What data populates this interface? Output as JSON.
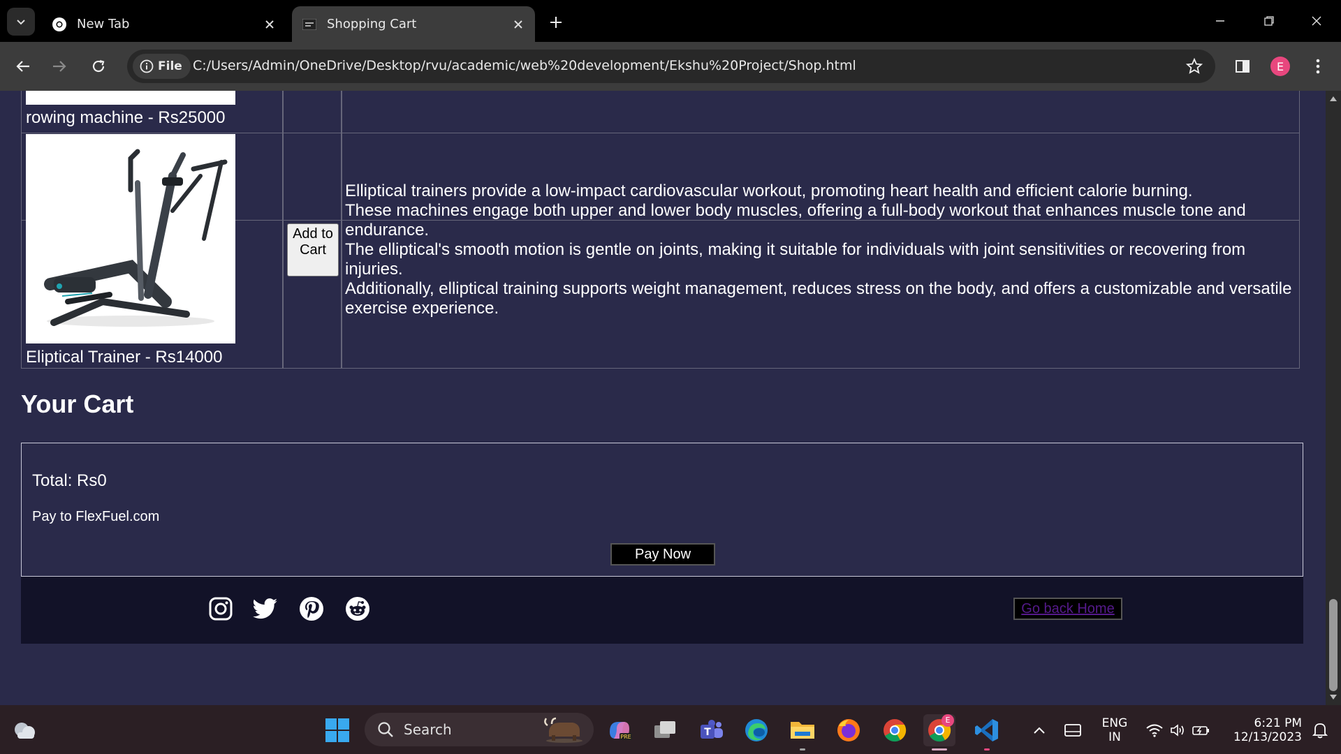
{
  "browser": {
    "tabs": [
      {
        "title": "New Tab",
        "icon": "chrome-icon"
      },
      {
        "title": "Shopping Cart",
        "icon": "page-icon"
      }
    ],
    "site_chip": "File",
    "url": "C:/Users/Admin/OneDrive/Desktop/rvu/academic/web%20development/Ekshu%20Project/Shop.html",
    "profile_initial": "E"
  },
  "products": [
    {
      "caption": "rowing machine - Rs25000"
    },
    {
      "caption": "Eliptical Trainer - Rs14000",
      "button_label": "Add to Cart",
      "description": [
        "Elliptical trainers provide a low-impact cardiovascular workout, promoting heart health and efficient calorie burning.",
        "These machines engage both upper and lower body muscles, offering a full-body workout that enhances muscle tone and endurance.",
        "The elliptical's smooth motion is gentle on joints, making it suitable for individuals with joint sensitivities or recovering from injuries.",
        "Additionally, elliptical training supports weight management, reduces stress on the body, and offers a customizable and versatile exercise experience."
      ]
    }
  ],
  "cart": {
    "heading": "Your Cart",
    "total": "Total: Rs0",
    "pay_to": "Pay to FlexFuel.com",
    "pay_button": "Pay Now"
  },
  "footer": {
    "social_icons": [
      "instagram-icon",
      "twitter-icon",
      "pinterest-icon",
      "reddit-icon"
    ],
    "home_link": "Go back Home"
  },
  "taskbar": {
    "search_placeholder": "Search",
    "language": "ENG",
    "region": "IN",
    "time": "6:21 PM",
    "date": "12/13/2023",
    "chrome_badge": "E"
  },
  "colors": {
    "page_background": "#2a2a4a",
    "footer_background": "#121228",
    "link_visited": "#551a8b"
  }
}
